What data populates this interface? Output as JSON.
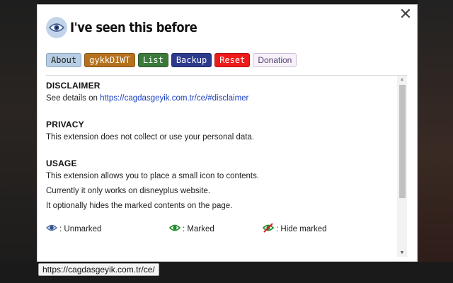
{
  "popup": {
    "title": "I've seen this before",
    "close_label": "✕"
  },
  "tabs": [
    {
      "label": "About",
      "color": "#b7cee4"
    },
    {
      "label": "gykkDIWT",
      "color": "#b5711d"
    },
    {
      "label": "List",
      "color": "#3b7a3b"
    },
    {
      "label": "Backup",
      "color": "#2d3a8c"
    },
    {
      "label": "Reset",
      "color": "#ee1a1a"
    },
    {
      "label": "Donation",
      "color": "#f6f2f8"
    }
  ],
  "about": {
    "disclaimer": {
      "heading": "DISCLAIMER",
      "text": "See details on ",
      "link": "https://cagdasgeyik.com.tr/ce/#disclaimer"
    },
    "privacy": {
      "heading": "PRIVACY",
      "text": "This extension does not collect or use your personal data."
    },
    "usage": {
      "heading": "USAGE",
      "lines": [
        "This extension allows you to place a small icon to contents.",
        "Currently it only works on disneyplus website.",
        "It optionally hides the marked contents on the page."
      ]
    },
    "legend": [
      {
        "label": ": Unmarked",
        "icon": "eye-unmarked-icon"
      },
      {
        "label": ": Marked",
        "icon": "eye-marked-icon"
      },
      {
        "label": ": Hide marked",
        "icon": "eye-hide-icon"
      }
    ]
  },
  "status_bar": {
    "url": "https://cagdasgeyik.com.tr/ce/"
  },
  "colors": {
    "link": "#1a3fc1",
    "marked_green": "#1f8a2b",
    "hide_red": "#d81b1b",
    "unmarked_blue": "#3f5c8f"
  }
}
